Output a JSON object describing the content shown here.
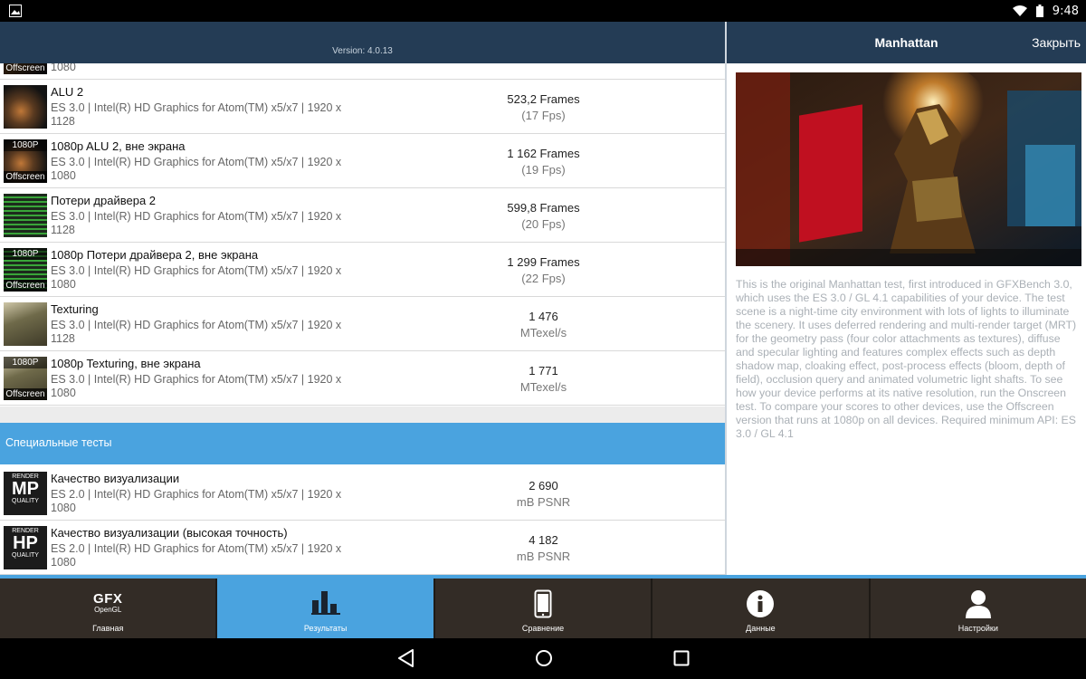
{
  "status_bar": {
    "time": "9:48"
  },
  "header": {
    "version": "Version: 4.0.13"
  },
  "partial_row": {
    "sub2": "1080",
    "tag_offscreen": "Offscreen"
  },
  "rows": [
    {
      "title": "ALU 2",
      "sub1": "ES 3.0 | Intel(R) HD Graphics for Atom(TM) x5/x7 | 1920 x",
      "sub2": "1128",
      "score": "523,2 Frames",
      "unit": "(17 Fps)",
      "thumb": "alu",
      "tag1080": "",
      "tag_offscreen": ""
    },
    {
      "title": "1080p ALU 2, вне экрана",
      "sub1": "ES 3.0 | Intel(R) HD Graphics for Atom(TM) x5/x7 | 1920 x",
      "sub2": "1080",
      "score": "1 162 Frames",
      "unit": "(19 Fps)",
      "thumb": "alu",
      "tag1080": "1080P",
      "tag_offscreen": "Offscreen"
    },
    {
      "title": "Потери драйвера 2",
      "sub1": "ES 3.0 | Intel(R) HD Graphics for Atom(TM) x5/x7 | 1920 x",
      "sub2": "1128",
      "score": "599,8 Frames",
      "unit": "(20 Fps)",
      "thumb": "driver",
      "tag1080": "",
      "tag_offscreen": ""
    },
    {
      "title": "1080p Потери драйвера 2, вне экрана",
      "sub1": "ES 3.0 | Intel(R) HD Graphics for Atom(TM) x5/x7 | 1920 x",
      "sub2": "1080",
      "score": "1 299 Frames",
      "unit": "(22 Fps)",
      "thumb": "driver",
      "tag1080": "1080P",
      "tag_offscreen": "Offscreen"
    },
    {
      "title": "Texturing",
      "sub1": "ES 3.0 | Intel(R) HD Graphics for Atom(TM) x5/x7 | 1920 x",
      "sub2": "1128",
      "score": "1 476",
      "unit": "MTexel/s",
      "thumb": "texture",
      "tag1080": "",
      "tag_offscreen": ""
    },
    {
      "title": "1080p Texturing, вне экрана",
      "sub1": "ES 3.0 | Intel(R) HD Graphics for Atom(TM) x5/x7 | 1920 x",
      "sub2": "1080",
      "score": "1 771",
      "unit": "MTexel/s",
      "thumb": "texture",
      "tag1080": "1080P",
      "tag_offscreen": "Offscreen"
    }
  ],
  "section": {
    "title": "Специальные тесты"
  },
  "special_rows": [
    {
      "title": "Качество визуализации",
      "sub1": "ES 2.0 | Intel(R) HD Graphics for Atom(TM) x5/x7 | 1920 x",
      "sub2": "1080",
      "score": "2 690",
      "unit": "mB PSNR",
      "badge_top": "RENDER",
      "badge_main": "MP",
      "badge_bottom": "QUALITY"
    },
    {
      "title": "Качество визуализации (высокая точность)",
      "sub1": "ES 2.0 | Intel(R) HD Graphics for Atom(TM) x5/x7 | 1920 x",
      "sub2": "1080",
      "score": "4 182",
      "unit": "mB PSNR",
      "badge_top": "RENDER",
      "badge_main": "HP",
      "badge_bottom": "QUALITY"
    }
  ],
  "detail": {
    "title": "Manhattan",
    "close_label": "Закрыть",
    "description": "This is the original Manhattan test, first introduced in GFXBench 3.0, which uses the ES 3.0 / GL 4.1 capabilities of your device. The test scene is a night-time city environment with lots of lights to illuminate the scenery. It uses deferred rendering and multi-render target (MRT) for the geometry pass (four color attachments as textures), diffuse and specular lighting and features complex effects such as depth shadow map, cloaking effect, post-process effects (bloom, depth of field), occlusion query and animated volumetric light shafts. To see how your device performs at its native resolution, run the Onscreen test. To compare your scores to other devices, use the Offscreen version that runs at 1080p on all devices.  Required minimum API: ES 3.0 / GL 4.1"
  },
  "nav": {
    "tabs": [
      {
        "label": "Главная",
        "icon": "gfx-opengl-icon",
        "logo_top": "GFX",
        "logo_bottom": "OpenGL"
      },
      {
        "label": "Результаты",
        "icon": "bar-chart-icon"
      },
      {
        "label": "Сравнение",
        "icon": "phone-icon"
      },
      {
        "label": "Данные",
        "icon": "info-icon"
      },
      {
        "label": "Настройки",
        "icon": "user-icon"
      }
    ],
    "active_index": 1
  },
  "colors": {
    "header": "#243c55",
    "accent": "#4aa3df",
    "nav_bg": "#332c26"
  }
}
